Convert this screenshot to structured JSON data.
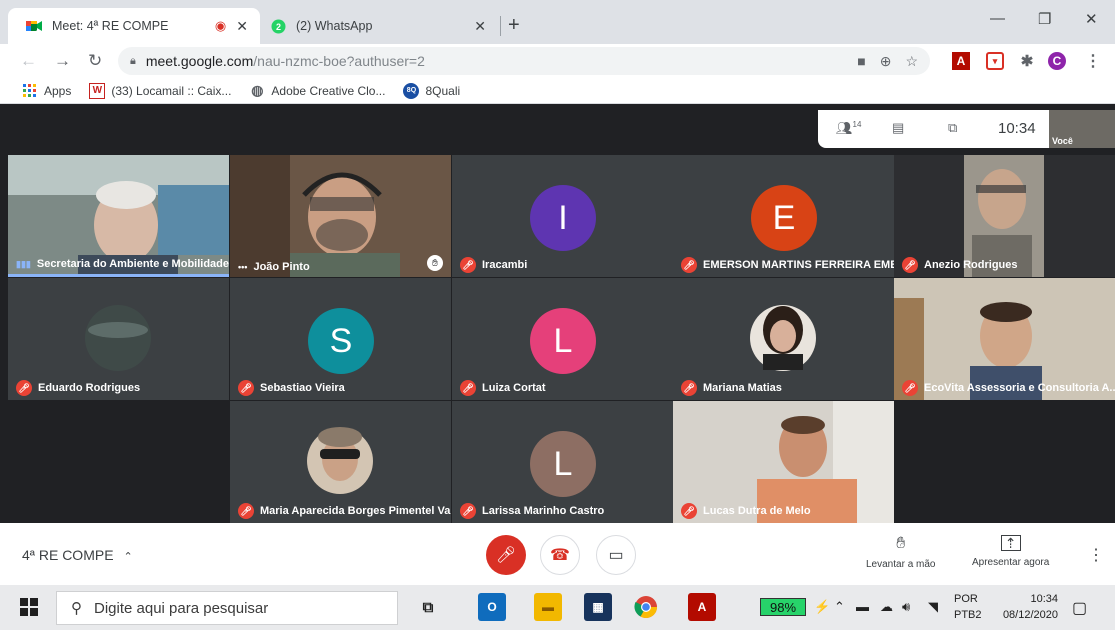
{
  "browser": {
    "tabs": [
      {
        "title": "Meet: 4ª RE COMPE",
        "active": true
      },
      {
        "title": "(2) WhatsApp",
        "active": false
      }
    ],
    "new_tab": "+",
    "window_controls": {
      "minimize": "—",
      "maximize": "❐",
      "close": "✕"
    },
    "url_host": "meet.google.com",
    "url_path": "/nau-nzmc-boe?authuser=2",
    "profile_initial": "C",
    "bookmarks": [
      {
        "label": "Apps",
        "icon": "apps-grid-icon"
      },
      {
        "label": "(33) Locamail :: Caix...",
        "icon": "W"
      },
      {
        "label": "Adobe Creative Clo...",
        "icon": "adobe-icon"
      },
      {
        "label": "8Quali",
        "icon": "8Q"
      }
    ]
  },
  "meet_topbar": {
    "participants_count": "14",
    "clock": "10:34",
    "self_label": "Você"
  },
  "participants": [
    {
      "name": "Secretaria do Ambiente e Mobilidade...",
      "muted": false,
      "speaking": true,
      "video": true,
      "bg": "#8a8f86"
    },
    {
      "name": "João Pinto",
      "muted": false,
      "speaking": false,
      "video": true,
      "bg": "#6f5a48"
    },
    {
      "name": "Iracambi",
      "muted": true,
      "initial": "I",
      "color": "#5e35b1"
    },
    {
      "name": "EMERSON MARTINS FERREIRA EME...",
      "muted": true,
      "initial": "E",
      "color": "#d84315"
    },
    {
      "name": "Anezio Rodrigues",
      "muted": true,
      "video": true,
      "bg": "#8c8a84"
    },
    {
      "name": "Eduardo Rodrigues",
      "muted": true,
      "photo": true,
      "color": "#3f4a48"
    },
    {
      "name": "Sebastiao Vieira",
      "muted": true,
      "initial": "S",
      "color": "#0e8f9c"
    },
    {
      "name": "Luiza Cortat",
      "muted": true,
      "initial": "L",
      "color": "#e5407a"
    },
    {
      "name": "Mariana Matias",
      "muted": true,
      "photo": true,
      "color": "#5b4636"
    },
    {
      "name": "EcoVita Assessoria e Consultoria A...",
      "muted": true,
      "video": true,
      "bg": "#b8ad9c"
    },
    {
      "name": "Maria Aparecida Borges Pimentel Va...",
      "muted": true,
      "photo": true,
      "color": "#6a6660"
    },
    {
      "name": "Larissa Marinho Castro",
      "muted": true,
      "initial": "L",
      "color": "#8d6e63"
    },
    {
      "name": "Lucas Dutra de Melo",
      "muted": true,
      "video": true,
      "bg": "#a89c8e"
    }
  ],
  "bottom": {
    "meeting_name": "4ª RE COMPE",
    "raise_hand": "Levantar a mão",
    "present_now": "Apresentar agora"
  },
  "taskbar": {
    "search_placeholder": "Digite aqui para pesquisar",
    "battery": "98%",
    "lang_1": "POR",
    "lang_2": "PTB2",
    "time": "10:34",
    "date": "08/12/2020"
  }
}
